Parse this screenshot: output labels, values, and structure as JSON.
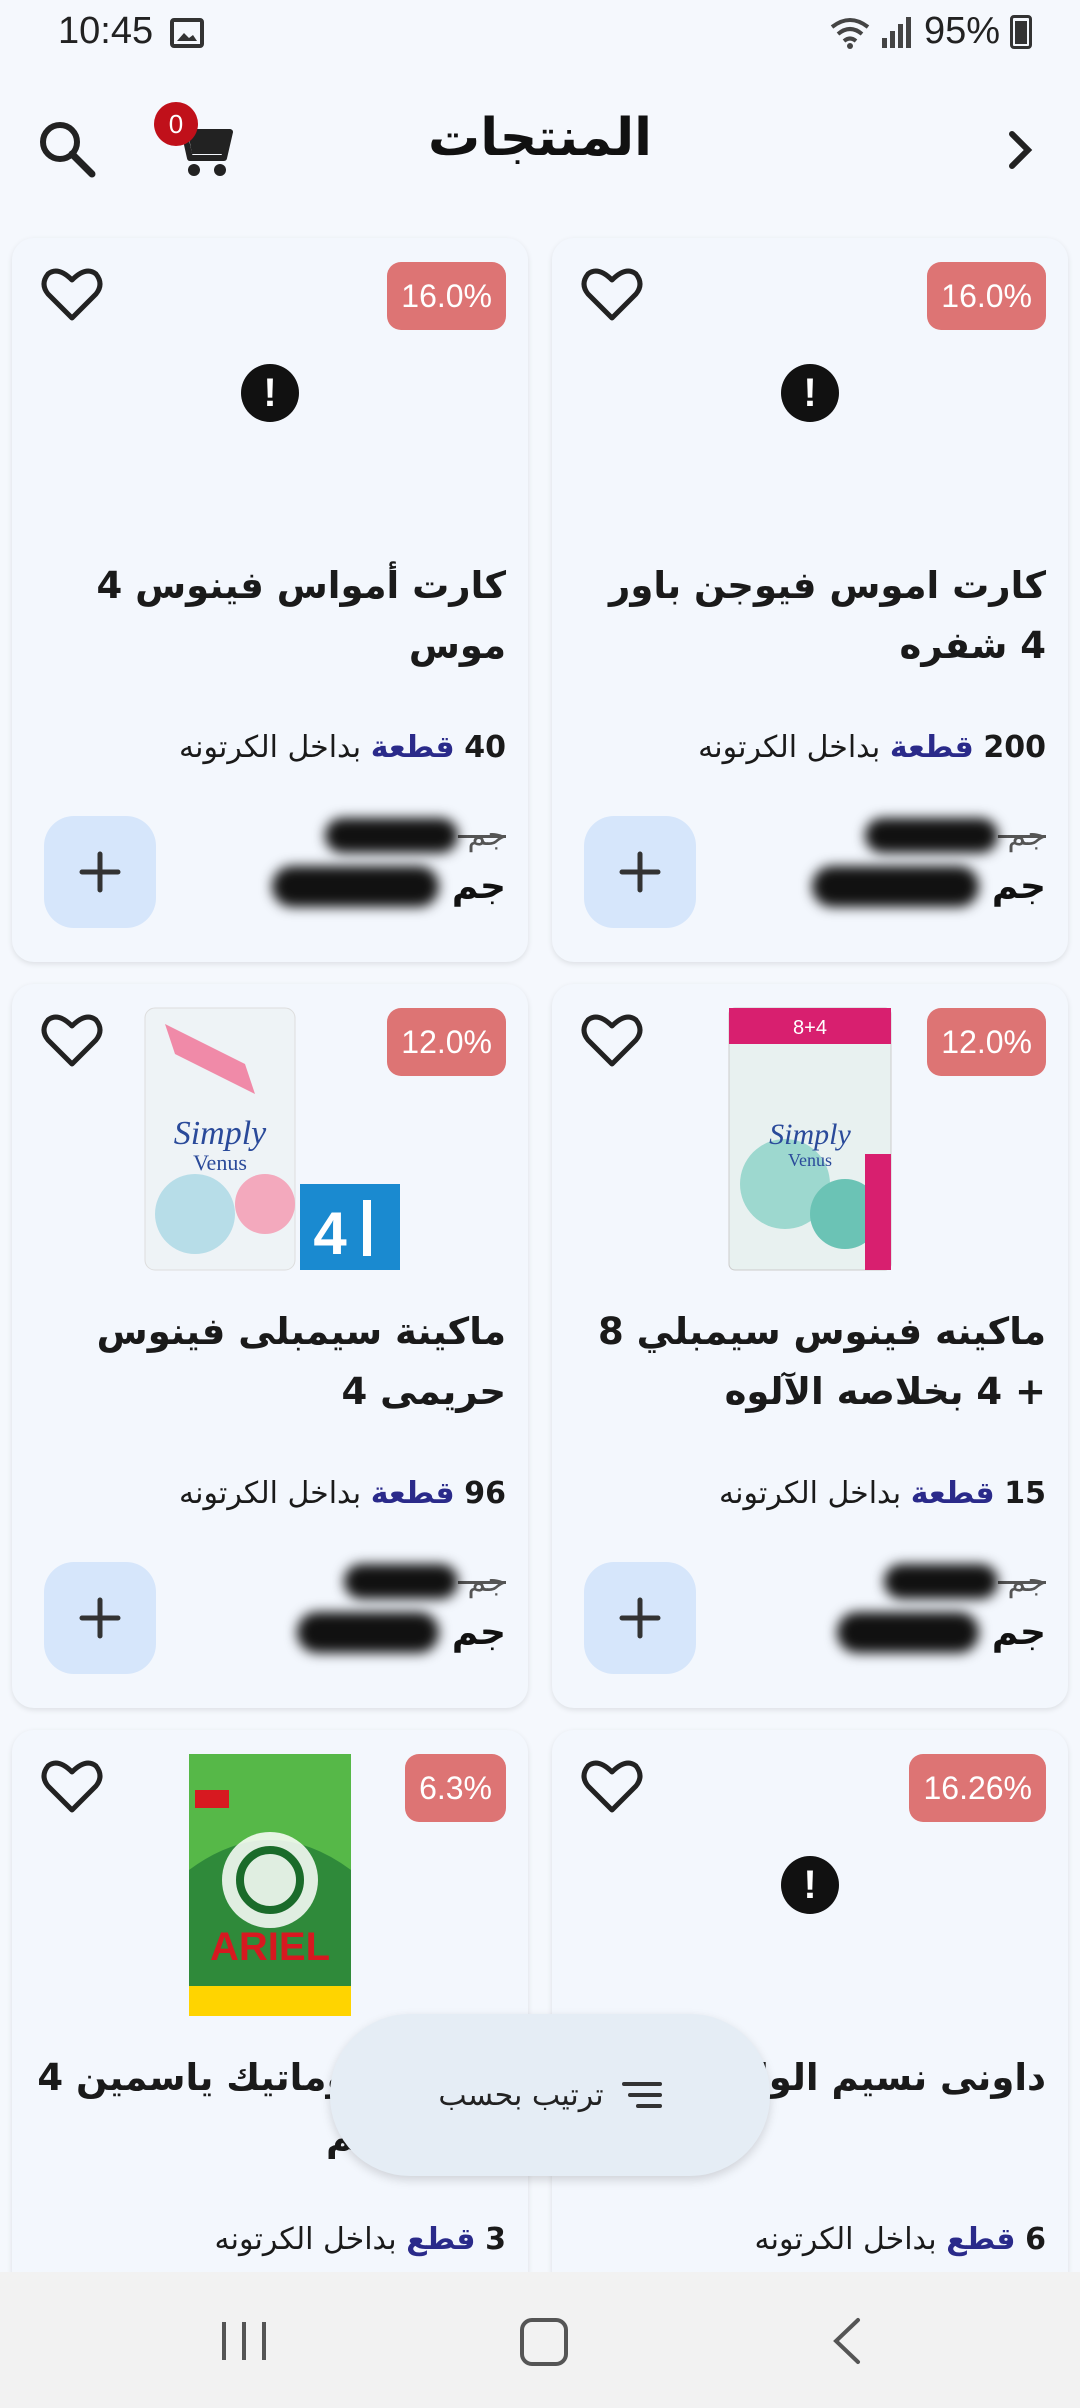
{
  "status": {
    "time": "10:45",
    "battery": "95%"
  },
  "header": {
    "title": "المنتجات",
    "cart_count": "0"
  },
  "products": [
    {
      "discount": "16.0%",
      "name": "كارت اموس فيوجن باور 4 شفره",
      "qty": "200",
      "unit": "قطعة",
      "qty_suffix": "بداخل الكرتونه",
      "old_price": "591.75",
      "new_price": "508.70",
      "currency": "جم",
      "image": "alert-icon"
    },
    {
      "discount": "16.0%",
      "name": "كارت أمواس فينوس 4 موس",
      "qty": "40",
      "unit": "قطعة",
      "qty_suffix": "بداخل الكرتونه",
      "old_price": "290.19",
      "new_price": "249.46",
      "currency": "جم",
      "image": "alert-icon"
    },
    {
      "discount": "12.0%",
      "name": "ماكينه فينوس سيمبلي 8 + 4 بخلاصه الآلوه",
      "qty": "15",
      "unit": "قطعة",
      "qty_suffix": "بداخل الكرتونه",
      "old_price": "96.50",
      "new_price": "86.34",
      "currency": "جم",
      "image": "venus-pack"
    },
    {
      "discount": "12.0%",
      "name": "ماكينة سيمبلى فينوس حريمى 4",
      "qty": "96",
      "unit": "قطعة",
      "qty_suffix": "بداخل الكرتونه",
      "old_price": "77.48",
      "new_price": "69.32",
      "currency": "جم",
      "image": "venus-pink-pack"
    },
    {
      "discount": "16.26%",
      "name": "داونى نسيم الوادي مركز",
      "qty": "6",
      "unit": "قطع",
      "qty_suffix": "بداخل الكرتونه",
      "image": "alert-icon"
    },
    {
      "discount": "6.3%",
      "name": "أريال أوتوماتيك ياسمين 4 كيلو خصم",
      "qty": "3",
      "unit": "قطع",
      "qty_suffix": "بداخل الكرتونه",
      "image": "ariel-pack"
    }
  ],
  "sort": {
    "label": "ترتيب بحسب"
  }
}
